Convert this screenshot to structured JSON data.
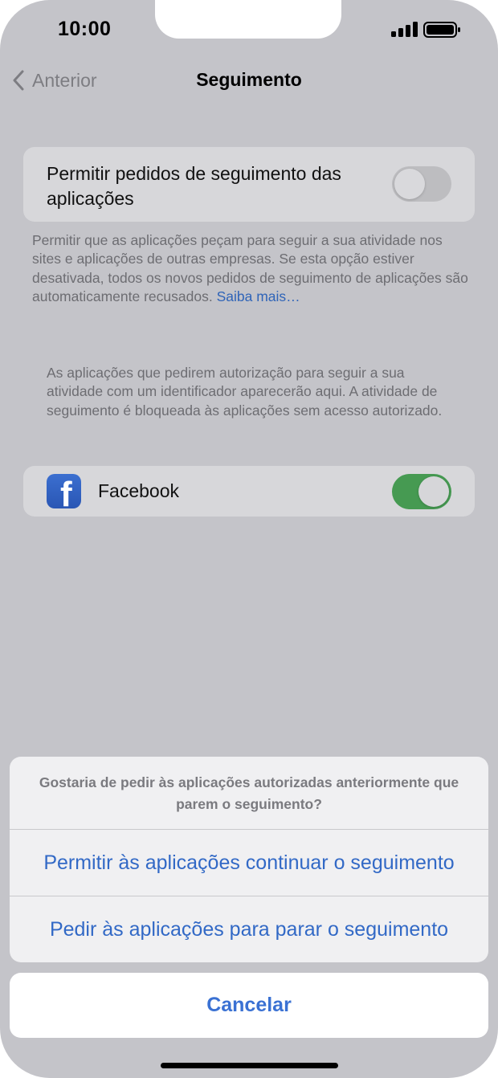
{
  "status_bar": {
    "time": "10:00",
    "signal_icon": "cellular-signal-icon",
    "battery_icon": "battery-icon"
  },
  "nav": {
    "back_icon": "chevron-left-icon",
    "back_label": "Anterior",
    "title": "Seguimento"
  },
  "tracking_toggle": {
    "label": "Permitir pedidos de seguimento das aplicações",
    "enabled": false
  },
  "description": {
    "text": "Permitir que as aplicações peçam para seguir a sua atividade nos sites e aplicações de outras empresas. Se esta opção estiver desativada, todos os novos pedidos de seguimento de aplicações são automaticamente recusados. ",
    "link": "Saiba mais…"
  },
  "apps_note": "As aplicações que pedirem autorização para seguir a sua atividade com um identificador aparecerão aqui. A atividade de seguimento é bloqueada às aplicações sem acesso autorizado.",
  "apps": [
    {
      "name": "Facebook",
      "icon": "facebook-icon",
      "icon_glyph": "f",
      "enabled": true
    }
  ],
  "action_sheet": {
    "message": "Gostaria de pedir às aplicações autorizadas anteriormente que parem o seguimento?",
    "actions": [
      "Permitir às aplicações continuar o seguimento",
      "Pedir às aplicações para parar o seguimento"
    ],
    "cancel": "Cancelar"
  },
  "colors": {
    "accent": "#3269c6",
    "switch_on": "#469a52",
    "dim_background": "#c4c4c9"
  }
}
